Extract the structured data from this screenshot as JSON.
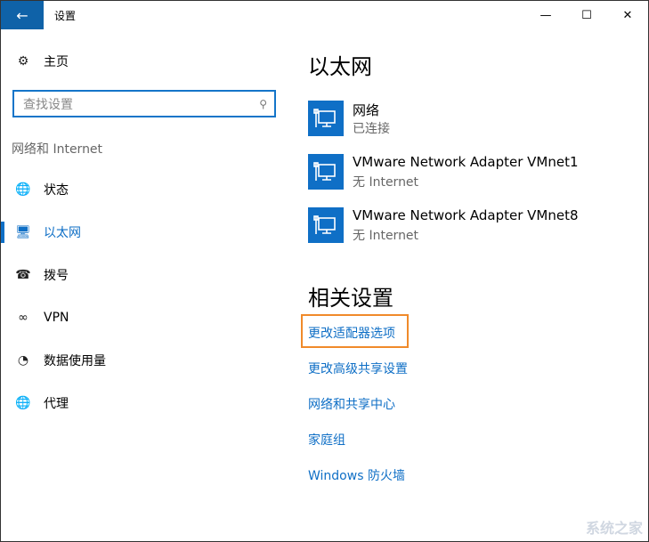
{
  "window": {
    "title": "设置",
    "minimize": "—",
    "maximize": "☐",
    "close": "✕"
  },
  "sidebar": {
    "home": "主页",
    "search_placeholder": "查找设置",
    "section": "网络和 Internet",
    "items": [
      {
        "label": "状态",
        "icon": "globe-status-icon"
      },
      {
        "label": "以太网",
        "icon": "ethernet-icon",
        "active": true
      },
      {
        "label": "拨号",
        "icon": "dialup-icon"
      },
      {
        "label": "VPN",
        "icon": "vpn-icon"
      },
      {
        "label": "数据使用量",
        "icon": "data-usage-icon"
      },
      {
        "label": "代理",
        "icon": "globe-icon"
      }
    ]
  },
  "main": {
    "title": "以太网",
    "networks": [
      {
        "name": "网络",
        "status": "已连接"
      },
      {
        "name": "VMware Network Adapter VMnet1",
        "status": "无 Internet"
      },
      {
        "name": "VMware Network Adapter VMnet8",
        "status": "无 Internet"
      }
    ],
    "related_title": "相关设置",
    "links": [
      "更改适配器选项",
      "更改高级共享设置",
      "网络和共享中心",
      "家庭组",
      "Windows 防火墙"
    ]
  },
  "colors": {
    "accent": "#0f6fc6",
    "highlight": "#f08a2a"
  },
  "watermark": "系统之家"
}
